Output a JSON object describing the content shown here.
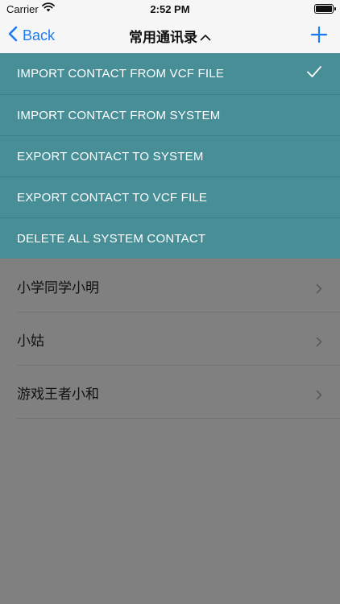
{
  "status_bar": {
    "carrier": "Carrier",
    "time": "2:52 PM",
    "wifi_icon": "wifi-icon",
    "battery_icon": "battery-icon"
  },
  "nav": {
    "back_label": "Back",
    "title": "常用通讯录",
    "title_caret_icon": "chevron-up-icon",
    "add_icon": "plus-icon",
    "accent_color": "#1a7cf5"
  },
  "menu": {
    "background_color": "#488e97",
    "items": [
      {
        "label": "IMPORT CONTACT FROM VCF FILE",
        "selected": true
      },
      {
        "label": "IMPORT CONTACT FROM SYSTEM",
        "selected": false
      },
      {
        "label": "EXPORT CONTACT TO SYSTEM",
        "selected": false
      },
      {
        "label": "EXPORT CONTACT TO VCF FILE",
        "selected": false
      },
      {
        "label": "DELETE ALL SYSTEM CONTACT",
        "selected": false
      }
    ]
  },
  "contacts": [
    {
      "name": "小学同学小明"
    },
    {
      "name": "小姑"
    },
    {
      "name": "游戏王者小和"
    }
  ]
}
